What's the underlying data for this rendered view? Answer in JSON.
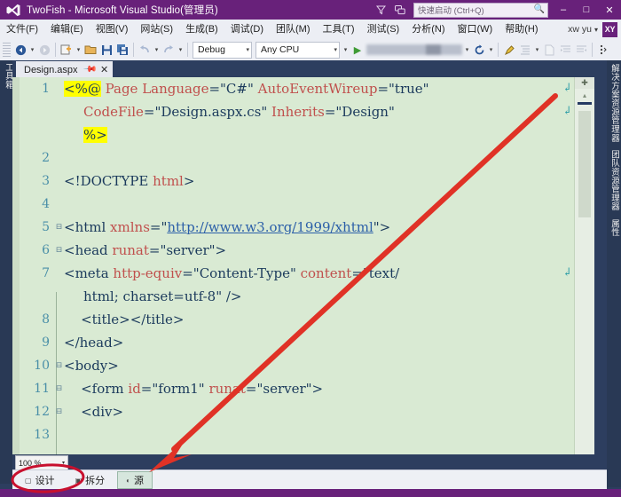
{
  "window": {
    "title": "TwoFish - Microsoft Visual Studio(管理员)",
    "logo_icon": "visual-studio-logo",
    "minimize_label": "–",
    "maximize_label": "□",
    "close_label": "✕",
    "filter_icon": "funnel-icon",
    "feedback_icon": "feedback-icon",
    "quick_launch": {
      "placeholder": "快速启动 (Ctrl+Q)",
      "search_icon": "magnifier-icon"
    }
  },
  "menubar": {
    "items": [
      {
        "label": "文件(F)"
      },
      {
        "label": "编辑(E)"
      },
      {
        "label": "视图(V)"
      },
      {
        "label": "网站(S)"
      },
      {
        "label": "生成(B)"
      },
      {
        "label": "调试(D)"
      },
      {
        "label": "团队(M)"
      },
      {
        "label": "工具(T)"
      },
      {
        "label": "测试(S)"
      },
      {
        "label": "分析(N)"
      },
      {
        "label": "窗口(W)"
      },
      {
        "label": "帮助(H)"
      }
    ],
    "account": {
      "name": "xw yu",
      "caret": "▾",
      "avatar_initials": "XY"
    }
  },
  "toolbar": {
    "nav_back_icon": "navigate-back-icon",
    "nav_forward_icon": "navigate-forward-icon",
    "new_project_icon": "new-project-icon",
    "open_file_icon": "open-file-icon",
    "save_icon": "save-icon",
    "save_all_icon": "save-all-icon",
    "undo_icon": "undo-icon",
    "redo_icon": "redo-icon",
    "configuration": {
      "value": "Debug",
      "caret": "▾"
    },
    "platform": {
      "value": "Any CPU",
      "caret": "▾"
    },
    "start_icon": "start-debug-play-icon",
    "browser_selector": "(redacted)",
    "refresh_icon": "refresh-icon",
    "highlight_icon": "highlight-icon",
    "indent_icon": "indent-icon",
    "comment_icon": "comment-icon",
    "uncomment_icon": "uncomment-icon",
    "overflow_icon": "toolbar-overflow-icon"
  },
  "docks": {
    "left": [
      {
        "label": "工具箱"
      }
    ],
    "right": [
      {
        "label": "解决方案资源管理器"
      },
      {
        "label": "团队资源管理器"
      },
      {
        "label": "属性"
      }
    ]
  },
  "document_tab": {
    "label": "Design.aspx",
    "pin_icon": "pin-icon",
    "close_icon": "close-icon"
  },
  "editor": {
    "lines": [
      {
        "num": "1",
        "fold": "",
        "indent": 0,
        "parts": [
          {
            "t": "<%@",
            "c": "k-hl"
          },
          {
            "t": " Page ",
            "c": "k-red"
          },
          {
            "t": "Language",
            "c": "k-red"
          },
          {
            "t": "=\"C#\" ",
            "c": "k-val"
          },
          {
            "t": "AutoEventWireup",
            "c": "k-red"
          },
          {
            "t": "=\"true\"",
            "c": "k-val"
          }
        ],
        "wrap": true
      },
      {
        "num": "",
        "fold": "",
        "indent": 1,
        "parts": [
          {
            "t": "CodeFile",
            "c": "k-red"
          },
          {
            "t": "=\"Design.aspx.cs\" ",
            "c": "k-val"
          },
          {
            "t": "Inherits",
            "c": "k-red"
          },
          {
            "t": "=\"Design\"",
            "c": "k-val"
          }
        ],
        "wrap": true
      },
      {
        "num": "",
        "fold": "",
        "indent": 1,
        "parts": [
          {
            "t": "%>",
            "c": "k-hl"
          }
        ],
        "wrap": false
      },
      {
        "num": "2",
        "fold": "",
        "indent": 0,
        "parts": [],
        "wrap": false
      },
      {
        "num": "3",
        "fold": "",
        "indent": 0,
        "parts": [
          {
            "t": "<!DOCTYPE ",
            "c": "k-tag"
          },
          {
            "t": "html",
            "c": "k-red"
          },
          {
            "t": ">",
            "c": "k-tag"
          }
        ],
        "wrap": false
      },
      {
        "num": "4",
        "fold": "",
        "indent": 0,
        "parts": [],
        "wrap": false
      },
      {
        "num": "5",
        "fold": "⊟",
        "indent": 0,
        "parts": [
          {
            "t": "<html ",
            "c": "k-tag"
          },
          {
            "t": "xmlns",
            "c": "k-red"
          },
          {
            "t": "=\"",
            "c": "k-val"
          },
          {
            "t": "http://www.w3.org/1999/xhtml",
            "c": "k-link"
          },
          {
            "t": "\">",
            "c": "k-val"
          }
        ],
        "wrap": false
      },
      {
        "num": "6",
        "fold": "⊟",
        "indent": 0,
        "parts": [
          {
            "t": "<head ",
            "c": "k-tag"
          },
          {
            "t": "runat",
            "c": "k-red"
          },
          {
            "t": "=\"server\">",
            "c": "k-val"
          }
        ],
        "wrap": false
      },
      {
        "num": "7",
        "fold": "",
        "indent": 0,
        "parts": [
          {
            "t": "<meta ",
            "c": "k-tag"
          },
          {
            "t": "http-equiv",
            "c": "k-red"
          },
          {
            "t": "=\"Content-Type\" ",
            "c": "k-val"
          },
          {
            "t": "content",
            "c": "k-red"
          },
          {
            "t": "=\"text/",
            "c": "k-val"
          }
        ],
        "wrap": true
      },
      {
        "num": "",
        "fold": "",
        "indent": 1,
        "parts": [
          {
            "t": "html; charset=utf-8\" />",
            "c": "k-val"
          }
        ],
        "wrap": false
      },
      {
        "num": "8",
        "fold": "",
        "indent": 0,
        "parts": [
          {
            "t": "    <title></title>",
            "c": "k-tag"
          }
        ],
        "wrap": false
      },
      {
        "num": "9",
        "fold": "",
        "indent": 0,
        "parts": [
          {
            "t": "</head>",
            "c": "k-tag"
          }
        ],
        "wrap": false
      },
      {
        "num": "10",
        "fold": "⊟",
        "indent": 0,
        "parts": [
          {
            "t": "<body>",
            "c": "k-tag"
          }
        ],
        "wrap": false
      },
      {
        "num": "11",
        "fold": "⊟",
        "indent": 0,
        "parts": [
          {
            "t": "    <form ",
            "c": "k-tag"
          },
          {
            "t": "id",
            "c": "k-red"
          },
          {
            "t": "=\"form1\" ",
            "c": "k-val"
          },
          {
            "t": "runat",
            "c": "k-red"
          },
          {
            "t": "=\"server\">",
            "c": "k-val"
          }
        ],
        "wrap": false
      },
      {
        "num": "12",
        "fold": "⊟",
        "indent": 0,
        "parts": [
          {
            "t": "    <div>",
            "c": "k-tag"
          }
        ],
        "wrap": false
      },
      {
        "num": "13",
        "fold": "",
        "indent": 0,
        "parts": [],
        "wrap": false
      }
    ],
    "wrap_glyph": "↲",
    "scrollbar": {
      "split_icon": "split-view-icon",
      "up_icon": "▴"
    }
  },
  "bottom": {
    "zoom": {
      "value": "100 %",
      "caret": "▾"
    },
    "view_tabs": [
      {
        "label": "设计",
        "icon": "design-view-icon",
        "selected": false
      },
      {
        "label": "拆分",
        "icon": "split-view-icon",
        "selected": false
      },
      {
        "label": "源",
        "icon": "source-view-icon",
        "selected": true
      }
    ]
  },
  "annotations": {
    "arrow_color": "#e03226",
    "highlight_color": "#c8102e",
    "arrow_description": "red-arrow-pointing-to-design-tab",
    "ellipse_description": "red-ellipse-around-design-tab"
  }
}
